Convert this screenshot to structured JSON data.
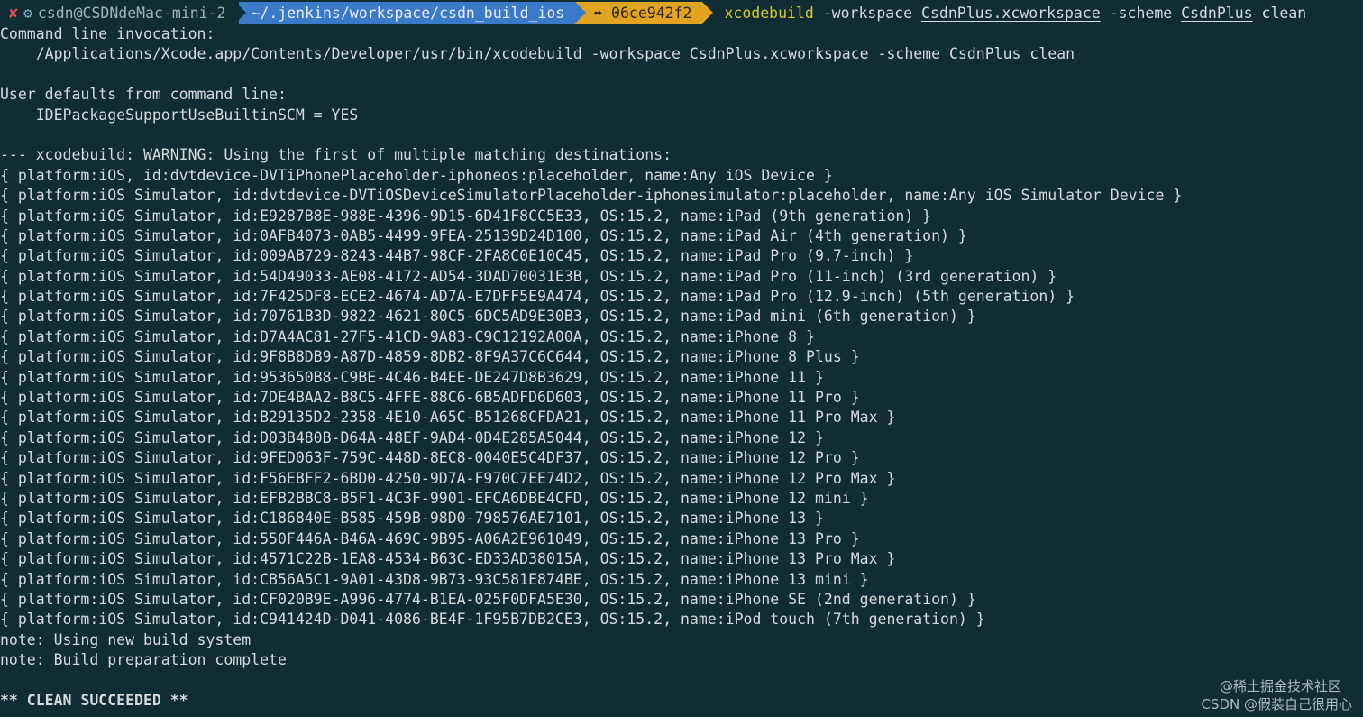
{
  "prompt": {
    "status_glyph": "✘",
    "gear_glyph": "⚙",
    "user_host": "csdn@CSDNdeMac-mini-2",
    "path": "~/.jenkins/workspace/csdn_build_ios",
    "git_branch": "⬌ 06ce942f2",
    "command": {
      "exe": "xcodebuild",
      "arg1": " -workspace ",
      "workspace": "CsdnPlus.xcworkspace",
      "arg2": " -scheme ",
      "scheme": "CsdnPlus",
      "arg3": " clean"
    }
  },
  "output_lines": [
    {
      "text": "Command line invocation:"
    },
    {
      "text": "    /Applications/Xcode.app/Contents/Developer/usr/bin/xcodebuild -workspace CsdnPlus.xcworkspace -scheme CsdnPlus clean"
    },
    {
      "text": ""
    },
    {
      "text": "User defaults from command line:"
    },
    {
      "text": "    IDEPackageSupportUseBuiltinSCM = YES"
    },
    {
      "text": ""
    },
    {
      "text": "--- xcodebuild: WARNING: Using the first of multiple matching destinations:"
    },
    {
      "text": "{ platform:iOS, id:dvtdevice-DVTiPhonePlaceholder-iphoneos:placeholder, name:Any iOS Device }"
    },
    {
      "text": "{ platform:iOS Simulator, id:dvtdevice-DVTiOSDeviceSimulatorPlaceholder-iphonesimulator:placeholder, name:Any iOS Simulator Device }"
    },
    {
      "text": "{ platform:iOS Simulator, id:E9287B8E-988E-4396-9D15-6D41F8CC5E33, OS:15.2, name:iPad (9th generation) }"
    },
    {
      "text": "{ platform:iOS Simulator, id:0AFB4073-0AB5-4499-9FEA-25139D24D100, OS:15.2, name:iPad Air (4th generation) }"
    },
    {
      "text": "{ platform:iOS Simulator, id:009AB729-8243-44B7-98CF-2FA8C0E10C45, OS:15.2, name:iPad Pro (9.7-inch) }"
    },
    {
      "text": "{ platform:iOS Simulator, id:54D49033-AE08-4172-AD54-3DAD70031E3B, OS:15.2, name:iPad Pro (11-inch) (3rd generation) }"
    },
    {
      "text": "{ platform:iOS Simulator, id:7F425DF8-ECE2-4674-AD7A-E7DFF5E9A474, OS:15.2, name:iPad Pro (12.9-inch) (5th generation) }"
    },
    {
      "text": "{ platform:iOS Simulator, id:70761B3D-9822-4621-80C5-6DC5AD9E30B3, OS:15.2, name:iPad mini (6th generation) }"
    },
    {
      "text": "{ platform:iOS Simulator, id:D7A4AC81-27F5-41CD-9A83-C9C12192A00A, OS:15.2, name:iPhone 8 }"
    },
    {
      "text": "{ platform:iOS Simulator, id:9F8B8DB9-A87D-4859-8DB2-8F9A37C6C644, OS:15.2, name:iPhone 8 Plus }"
    },
    {
      "text": "{ platform:iOS Simulator, id:953650B8-C9BE-4C46-B4EE-DE247D8B3629, OS:15.2, name:iPhone 11 }"
    },
    {
      "text": "{ platform:iOS Simulator, id:7DE4BAA2-B8C5-4FFE-88C6-6B5ADFD6D603, OS:15.2, name:iPhone 11 Pro }"
    },
    {
      "text": "{ platform:iOS Simulator, id:B29135D2-2358-4E10-A65C-B51268CFDA21, OS:15.2, name:iPhone 11 Pro Max }"
    },
    {
      "text": "{ platform:iOS Simulator, id:D03B480B-D64A-48EF-9AD4-0D4E285A5044, OS:15.2, name:iPhone 12 }"
    },
    {
      "text": "{ platform:iOS Simulator, id:9FED063F-759C-448D-8EC8-0040E5C4DF37, OS:15.2, name:iPhone 12 Pro }"
    },
    {
      "text": "{ platform:iOS Simulator, id:F56EBFF2-6BD0-4250-9D7A-F970C7EE74D2, OS:15.2, name:iPhone 12 Pro Max }"
    },
    {
      "text": "{ platform:iOS Simulator, id:EFB2BBC8-B5F1-4C3F-9901-EFCA6DBE4CFD, OS:15.2, name:iPhone 12 mini }"
    },
    {
      "text": "{ platform:iOS Simulator, id:C186840E-B585-459B-98D0-798576AE7101, OS:15.2, name:iPhone 13 }"
    },
    {
      "text": "{ platform:iOS Simulator, id:550F446A-B46A-469C-9B95-A06A2E961049, OS:15.2, name:iPhone 13 Pro }"
    },
    {
      "text": "{ platform:iOS Simulator, id:4571C22B-1EA8-4534-B63C-ED33AD38015A, OS:15.2, name:iPhone 13 Pro Max }"
    },
    {
      "text": "{ platform:iOS Simulator, id:CB56A5C1-9A01-43D8-9B73-93C581E874BE, OS:15.2, name:iPhone 13 mini }"
    },
    {
      "text": "{ platform:iOS Simulator, id:CF020B9E-A996-4774-B1EA-025F0DFA5E30, OS:15.2, name:iPhone SE (2nd generation) }"
    },
    {
      "text": "{ platform:iOS Simulator, id:C941424D-D041-4086-BE4F-1F95B7DB2CE3, OS:15.2, name:iPod touch (7th generation) }"
    },
    {
      "text": "note: Using new build system"
    },
    {
      "text": "note: Build preparation complete"
    },
    {
      "text": ""
    },
    {
      "text": "** CLEAN SUCCEEDED **",
      "bold": true
    }
  ],
  "watermarks": {
    "line1": "@稀土掘金技术社区",
    "line2": "CSDN @假装自己很用心"
  },
  "colors": {
    "background": "#0f2d33",
    "text": "#d5dadb",
    "path_segment": "#3b79c9",
    "git_segment": "#e0a422",
    "status_error": "#e55050",
    "command_exe": "#d3c63a"
  }
}
